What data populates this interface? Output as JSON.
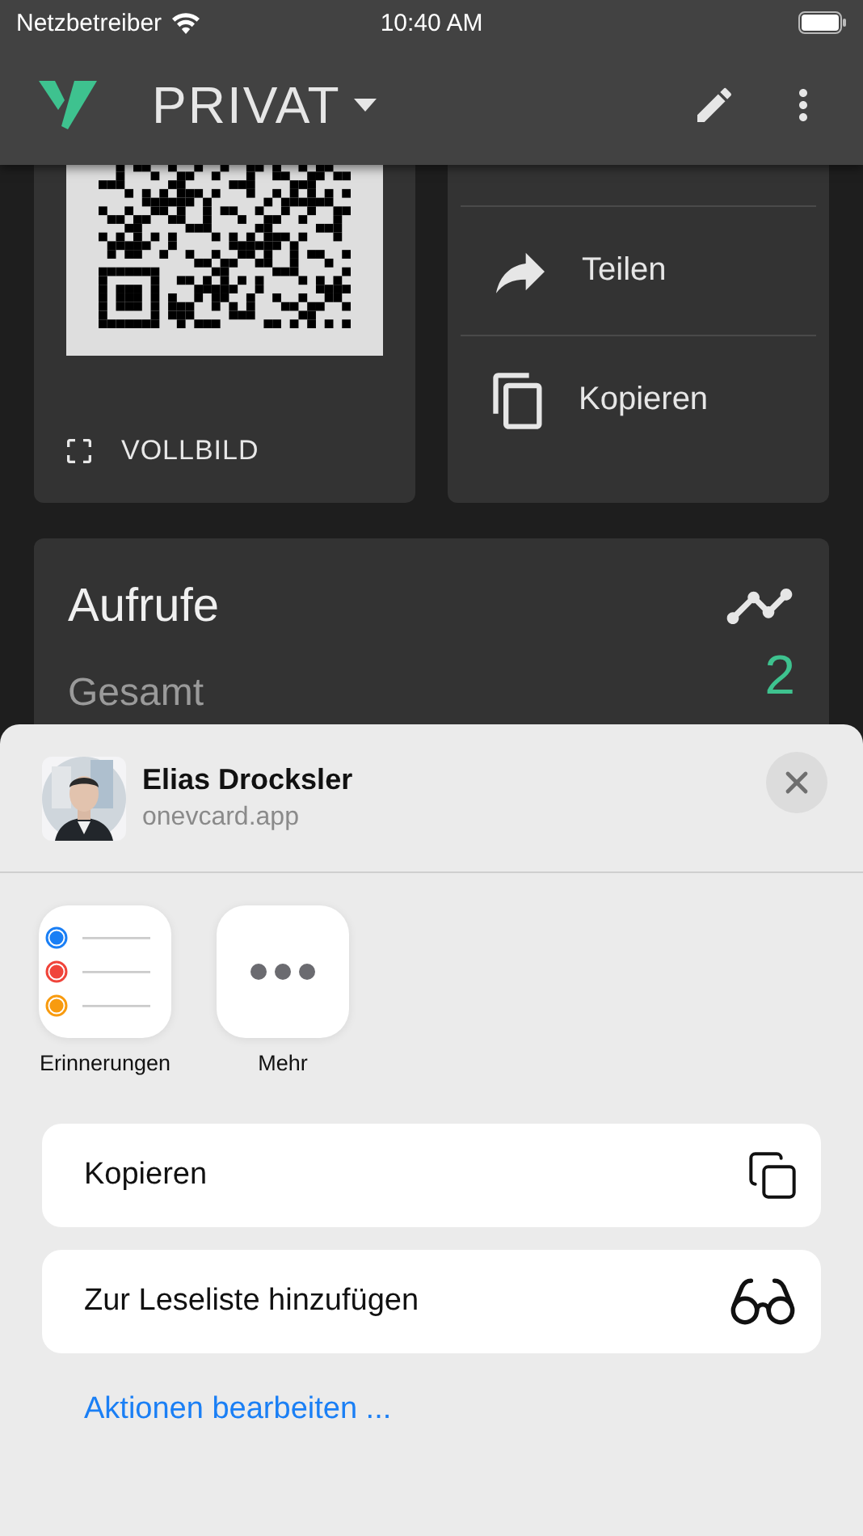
{
  "status_bar": {
    "carrier": "Netzbetreiber",
    "time": "10:40 AM"
  },
  "app_bar": {
    "title": "PRIVAT"
  },
  "qr_card": {
    "fullscreen_label": "VOLLBILD"
  },
  "actions_card": {
    "items": [
      {
        "kind": "share",
        "label": "Teilen"
      },
      {
        "kind": "copy",
        "label": "Kopieren"
      }
    ]
  },
  "views_card": {
    "title": "Aufrufe",
    "total_label": "Gesamt",
    "total_value": "2"
  },
  "share_sheet": {
    "title": "Elias Drocksler",
    "subtitle": "onevcard.app",
    "apps": [
      {
        "kind": "reminders",
        "label": "Erinnerungen"
      },
      {
        "kind": "more",
        "label": "Mehr"
      }
    ],
    "actions": [
      {
        "kind": "copy",
        "label": "Kopieren"
      },
      {
        "kind": "reading_list",
        "label": "Zur Leseliste hinzufügen"
      }
    ],
    "edit_link": "Aktionen bearbeiten ..."
  }
}
